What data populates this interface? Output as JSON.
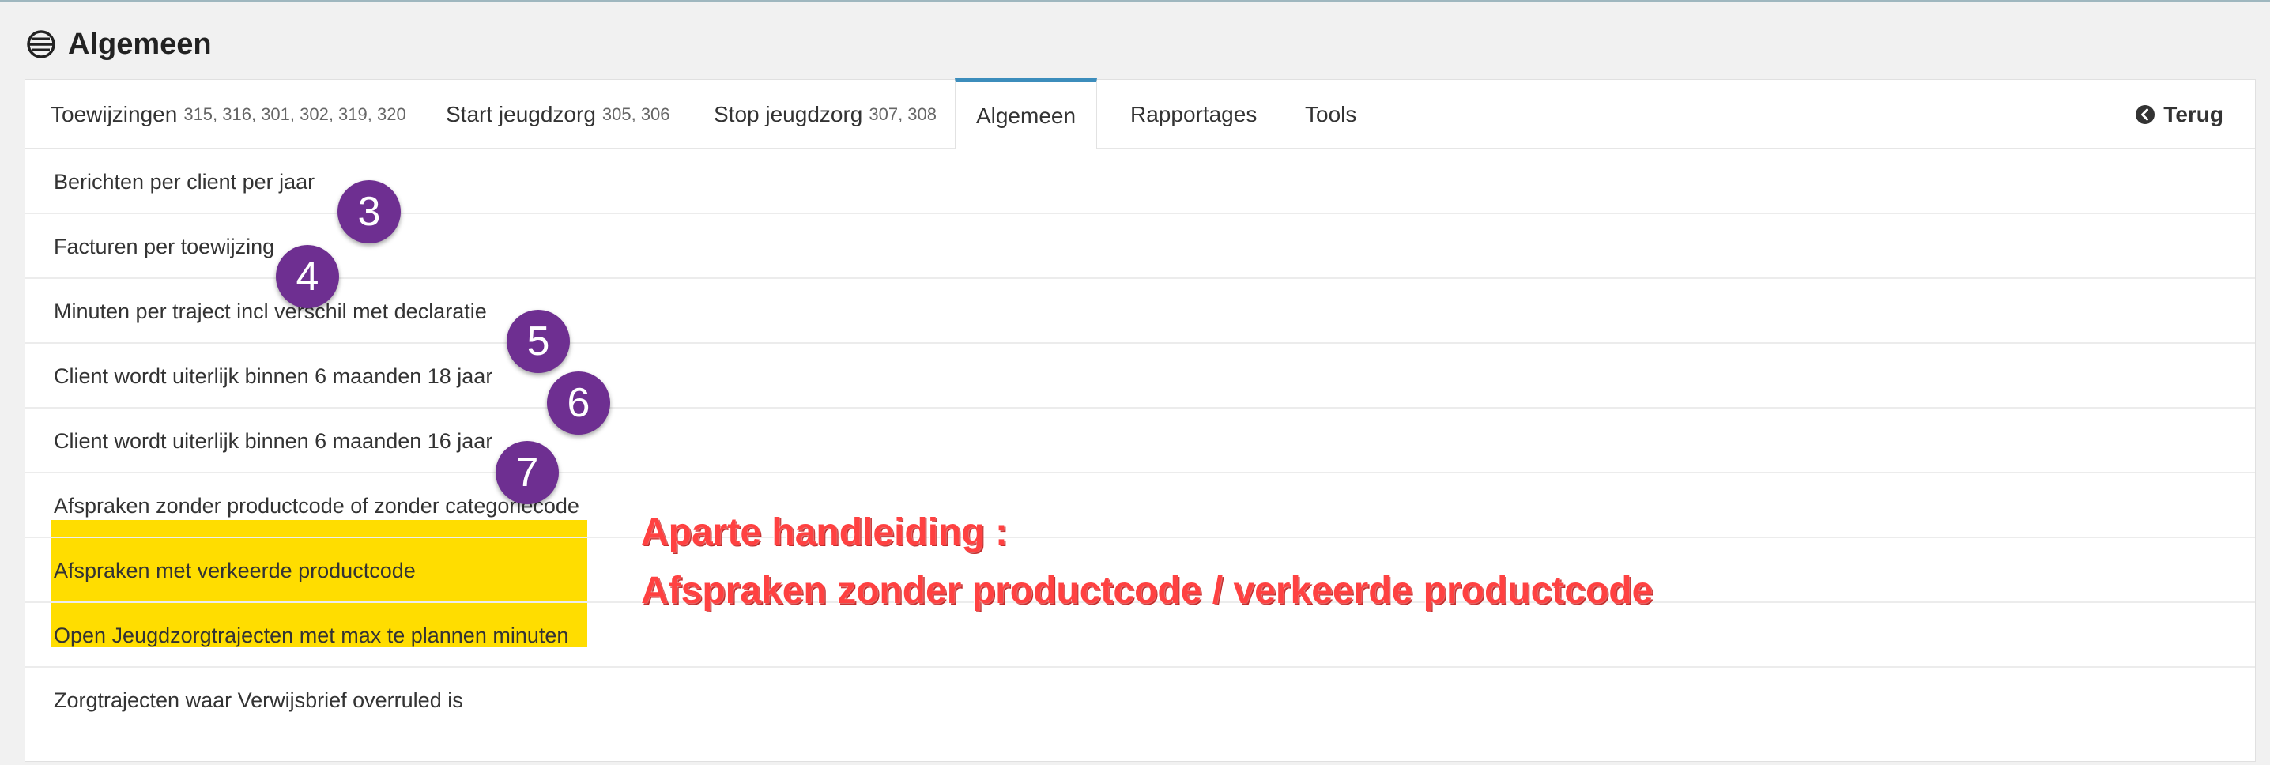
{
  "page": {
    "title": "Algemeen"
  },
  "tabs": [
    {
      "label": "Toewijzingen",
      "codes": "315, 316, 301, 302, 319, 320"
    },
    {
      "label": "Start jeugdzorg",
      "codes": "305, 306"
    },
    {
      "label": "Stop jeugdzorg",
      "codes": "307, 308"
    },
    {
      "label": "Algemeen",
      "codes": ""
    },
    {
      "label": "Rapportages",
      "codes": ""
    },
    {
      "label": "Tools",
      "codes": ""
    }
  ],
  "back": {
    "label": "Terug"
  },
  "rows": [
    {
      "label": "Berichten per client per jaar"
    },
    {
      "label": "Facturen per toewijzing"
    },
    {
      "label": "Minuten per traject incl verschil met declaratie"
    },
    {
      "label": "Client wordt uiterlijk binnen 6 maanden 18 jaar"
    },
    {
      "label": "Client wordt uiterlijk binnen 6 maanden 16 jaar"
    },
    {
      "label": "Afspraken zonder productcode of zonder categoriecode"
    },
    {
      "label": "Afspraken met verkeerde productcode"
    },
    {
      "label": "Open Jeugdzorgtrajecten met max te plannen minuten"
    },
    {
      "label": "Zorgtrajecten waar Verwijsbrief overruled is"
    }
  ],
  "badges": [
    "3",
    "4",
    "5",
    "6",
    "7"
  ],
  "annotation": {
    "line1": "Aparte handleiding :",
    "line2": "Afspraken zonder productcode / verkeerde productcode"
  },
  "colors": {
    "accent": "#3c8dbc",
    "badge": "#6e2f91",
    "highlight": "#ffdd00",
    "annotation": "#ff4141"
  }
}
